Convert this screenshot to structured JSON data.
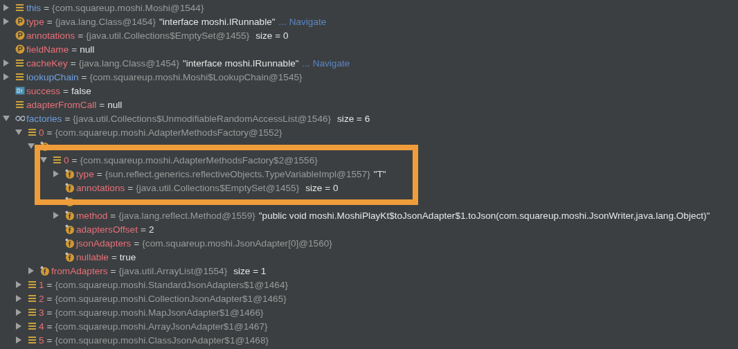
{
  "tree": [
    {
      "kind": "lines",
      "expanded": false,
      "name": "this",
      "sep": "=",
      "color": "#6f9fe0",
      "ref": "{com.squareup.moshi.Moshi@1544}"
    },
    {
      "kind": "param",
      "expanded": false,
      "name": "type",
      "sep": "=",
      "color": "#e8707a",
      "ref": "{java.lang.Class@1454}",
      "text": "\"interface moshi.IRunnable\"",
      "link": "... Navigate"
    },
    {
      "kind": "param",
      "name": "annotations",
      "sep": "=",
      "color": "#e8707a",
      "ref": "{java.util.Collections$EmptySet@1455}",
      "size": "size = 0"
    },
    {
      "kind": "param",
      "name": "fieldName",
      "sep": "=",
      "color": "#e8707a",
      "text": "null"
    },
    {
      "kind": "lines",
      "expanded": false,
      "name": "cacheKey",
      "sep": "=",
      "color": "#e8707a",
      "ref": "{java.lang.Class@1454}",
      "text": "\"interface moshi.IRunnable\"",
      "link": "... Navigate"
    },
    {
      "kind": "lines",
      "expanded": false,
      "name": "lookupChain",
      "sep": "=",
      "color": "#6f9fe0",
      "ref": "{com.squareup.moshi.Moshi$LookupChain@1545}"
    },
    {
      "kind": "boolean",
      "name": "success",
      "sep": "=",
      "color": "#e8707a",
      "text": "false"
    },
    {
      "kind": "lines",
      "name": "adapterFromCall",
      "sep": "=",
      "color": "#e8707a",
      "text": "null"
    },
    {
      "kind": "infinity",
      "expanded": true,
      "name": "factories",
      "sep": "=",
      "color": "#6f9fe0",
      "ref": "{java.util.Collections$UnmodifiableRandomAccessList@1546}",
      "size": "size = 6",
      "children": [
        {
          "kind": "lines",
          "expanded": true,
          "name": "0",
          "sep": "=",
          "color": "#e8707a",
          "ref": "{com.squareup.moshi.AdapterMethodsFactory@1552}",
          "children": [
            {
              "kind": "field",
              "expanded": true,
              "children": [
                {
                  "kind": "lines",
                  "expanded": true,
                  "name": "0",
                  "sep": "=",
                  "color": "#e8707a",
                  "ref": "{com.squareup.moshi.AdapterMethodsFactory$2@1556}",
                  "children": [
                    {
                      "kind": "field",
                      "expanded": false,
                      "name": "type",
                      "sep": "=",
                      "color": "#e8707a",
                      "ref": "{sun.reflect.generics.reflectiveObjects.TypeVariableImpl@1557}",
                      "text": "\"T\""
                    },
                    {
                      "kind": "field",
                      "name": "annotations",
                      "sep": "=",
                      "color": "#e8707a",
                      "ref": "{java.util.Collections$EmptySet@1455}",
                      "size": "size = 0"
                    },
                    {
                      "kind": "field"
                    },
                    {
                      "kind": "field",
                      "expanded": false,
                      "name": "method",
                      "sep": "=",
                      "color": "#e8707a",
                      "ref": "{java.lang.reflect.Method@1559}",
                      "text": "\"public void moshi.MoshiPlayKt$toJsonAdapter$1.toJson(com.squareup.moshi.JsonWriter,java.lang.Object)\""
                    },
                    {
                      "kind": "field",
                      "name": "adaptersOffset",
                      "sep": "=",
                      "color": "#e8707a",
                      "text": "2"
                    },
                    {
                      "kind": "field",
                      "name": "jsonAdapters",
                      "sep": "=",
                      "color": "#e8707a",
                      "ref": "{com.squareup.moshi.JsonAdapter[0]@1560}"
                    },
                    {
                      "kind": "field",
                      "name": "nullable",
                      "sep": "=",
                      "color": "#e8707a",
                      "text": "true"
                    }
                  ]
                }
              ]
            },
            {
              "kind": "field",
              "expanded": false,
              "name": "fromAdapters",
              "sep": "=",
              "color": "#e8707a",
              "ref": "{java.util.ArrayList@1554}",
              "size": "size = 1"
            }
          ]
        },
        {
          "kind": "lines",
          "expanded": false,
          "name": "1",
          "sep": "=",
          "color": "#e8707a",
          "ref": "{com.squareup.moshi.StandardJsonAdapters$1@1464}"
        },
        {
          "kind": "lines",
          "expanded": false,
          "name": "2",
          "sep": "=",
          "color": "#e8707a",
          "ref": "{com.squareup.moshi.CollectionJsonAdapter$1@1465}"
        },
        {
          "kind": "lines",
          "expanded": false,
          "name": "3",
          "sep": "=",
          "color": "#e8707a",
          "ref": "{com.squareup.moshi.MapJsonAdapter$1@1466}"
        },
        {
          "kind": "lines",
          "expanded": false,
          "name": "4",
          "sep": "=",
          "color": "#e8707a",
          "ref": "{com.squareup.moshi.ArrayJsonAdapter$1@1467}"
        },
        {
          "kind": "lines",
          "expanded": false,
          "name": "5",
          "sep": "=",
          "color": "#e8707a",
          "ref": "{com.squareup.moshi.ClassJsonAdapter$1@1468}"
        }
      ]
    }
  ],
  "highlight": {
    "shown": true
  }
}
